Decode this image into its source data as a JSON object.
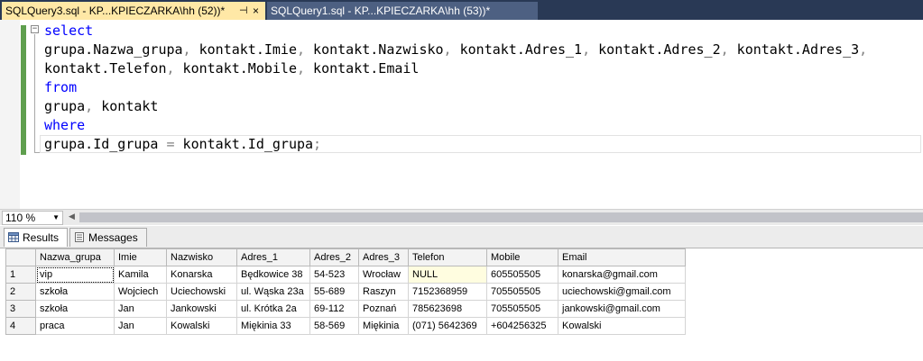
{
  "tabs": [
    {
      "label": "SQLQuery3.sql - KP...KPIECZARKA\\hh (52))*",
      "pin": "⊣",
      "close": "×"
    },
    {
      "label": "SQLQuery1.sql - KP...KPIECZARKA\\hh (53))*"
    }
  ],
  "editor": {
    "fold_symbol": "−",
    "lines": [
      "select",
      "grupa.Nazwa_grupa, kontakt.Imie, kontakt.Nazwisko, kontakt.Adres_1, kontakt.Adres_2, kontakt.Adres_3,",
      "kontakt.Telefon, kontakt.Mobile, kontakt.Email",
      "from",
      "grupa, kontakt",
      "where",
      "grupa.Id_grupa = kontakt.Id_grupa;"
    ]
  },
  "zoom": {
    "value": "110 %",
    "dropdown": "▼"
  },
  "scroll_left": "◀",
  "results_tabs": [
    {
      "label": "Results"
    },
    {
      "label": "Messages"
    }
  ],
  "grid": {
    "columns": [
      "Nazwa_grupa",
      "Imie",
      "Nazwisko",
      "Adres_1",
      "Adres_2",
      "Adres_3",
      "Telefon",
      "Mobile",
      "Email"
    ],
    "rows": [
      {
        "n": "1",
        "cells": [
          "vip",
          "Kamila",
          "Konarska",
          "Będkowice 38",
          "54-523",
          "Wrocław",
          "NULL",
          "605505505",
          "konarska@gmail.com"
        ]
      },
      {
        "n": "2",
        "cells": [
          "szkoła",
          "Wojciech",
          "Uciechowski",
          "ul. Wąska 23a",
          "55-689",
          "Raszyn",
          "7152368959",
          "705505505",
          "uciechowski@gmail.com"
        ]
      },
      {
        "n": "3",
        "cells": [
          "szkoła",
          "Jan",
          "Jankowski",
          "ul. Krótka 2a",
          "69-112",
          "Poznań",
          "785623698",
          "705505505",
          "jankowski@gmail.com"
        ]
      },
      {
        "n": "4",
        "cells": [
          "praca",
          "Jan",
          "Kowalski",
          "Miękinia 33",
          "58-569",
          "Miękinia",
          "(071) 5642369",
          "+604256325",
          "Kowalski"
        ]
      }
    ]
  }
}
